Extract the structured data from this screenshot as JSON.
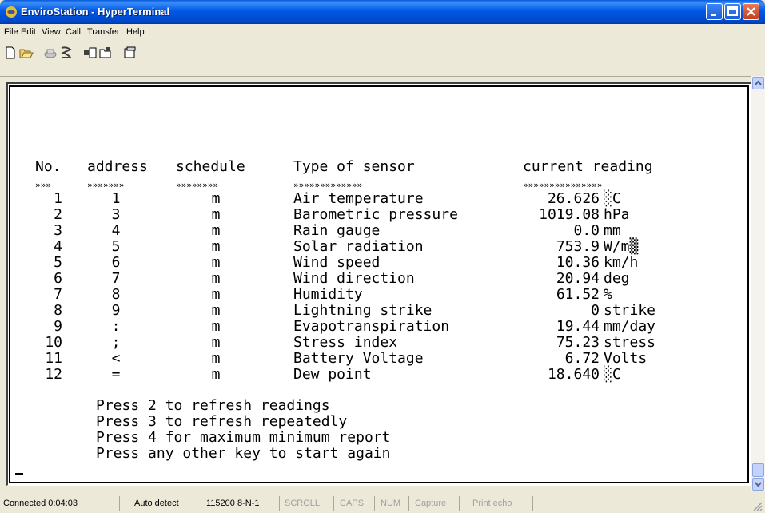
{
  "window": {
    "title": "EnviroStation - HyperTerminal"
  },
  "menu": [
    "File",
    "Edit",
    "View",
    "Call",
    "Transfer",
    "Help"
  ],
  "toolbar_icons": [
    "new-connection-icon",
    "open-icon",
    "disconnect-icon",
    "dial-icon",
    "send-icon",
    "receive-icon",
    "properties-icon"
  ],
  "terminal": {
    "headers": {
      "no": "No.",
      "address": "address",
      "schedule": "schedule",
      "type": "Type of sensor",
      "reading": "current reading"
    },
    "underline": {
      "no": "»»»",
      "address": "»»»»»»»",
      "schedule": "»»»»»»»»",
      "type": "»»»»»»»»»»»»»",
      "reading": "»»»»»»»»»»»»»»»"
    },
    "rows": [
      {
        "no": "1",
        "address": "1",
        "schedule": "m",
        "type": "Air temperature",
        "value": "26.626",
        "unit": "░C"
      },
      {
        "no": "2",
        "address": "3",
        "schedule": "m",
        "type": "Barometric pressure",
        "value": "1019.08",
        "unit": "hPa"
      },
      {
        "no": "3",
        "address": "4",
        "schedule": "m",
        "type": "Rain gauge",
        "value": "0.0",
        "unit": "mm"
      },
      {
        "no": "4",
        "address": "5",
        "schedule": "m",
        "type": "Solar radiation",
        "value": "753.9",
        "unit": "W/m▒"
      },
      {
        "no": "5",
        "address": "6",
        "schedule": "m",
        "type": "Wind speed",
        "value": "10.36",
        "unit": "km/h"
      },
      {
        "no": "6",
        "address": "7",
        "schedule": "m",
        "type": "Wind direction",
        "value": "20.94",
        "unit": "deg"
      },
      {
        "no": "7",
        "address": "8",
        "schedule": "m",
        "type": "Humidity",
        "value": "61.52",
        "unit": "%"
      },
      {
        "no": "8",
        "address": "9",
        "schedule": "m",
        "type": "Lightning strike",
        "value": "0",
        "unit": "strike"
      },
      {
        "no": "9",
        "address": ":",
        "schedule": "m",
        "type": "Evapotranspiration",
        "value": "19.44",
        "unit": "mm/day"
      },
      {
        "no": "10",
        "address": ";",
        "schedule": "m",
        "type": "Stress index",
        "value": "75.23",
        "unit": "stress"
      },
      {
        "no": "11",
        "address": "<",
        "schedule": "m",
        "type": "Battery Voltage",
        "value": "6.72",
        "unit": "Volts"
      },
      {
        "no": "12",
        "address": "=",
        "schedule": "m",
        "type": "Dew point",
        "value": "18.640",
        "unit": "░C"
      }
    ],
    "prompts": [
      "Press 2 to refresh readings",
      "Press 3 to refresh repeatedly",
      "Press 4 for maximum minimum report",
      "Press any other key to start again"
    ]
  },
  "status": {
    "connected": "Connected 0:04:03",
    "detect": "Auto detect",
    "port": "115200 8-N-1",
    "scroll": "SCROLL",
    "caps": "CAPS",
    "num": "NUM",
    "capture": "Capture",
    "print": "Print echo"
  }
}
